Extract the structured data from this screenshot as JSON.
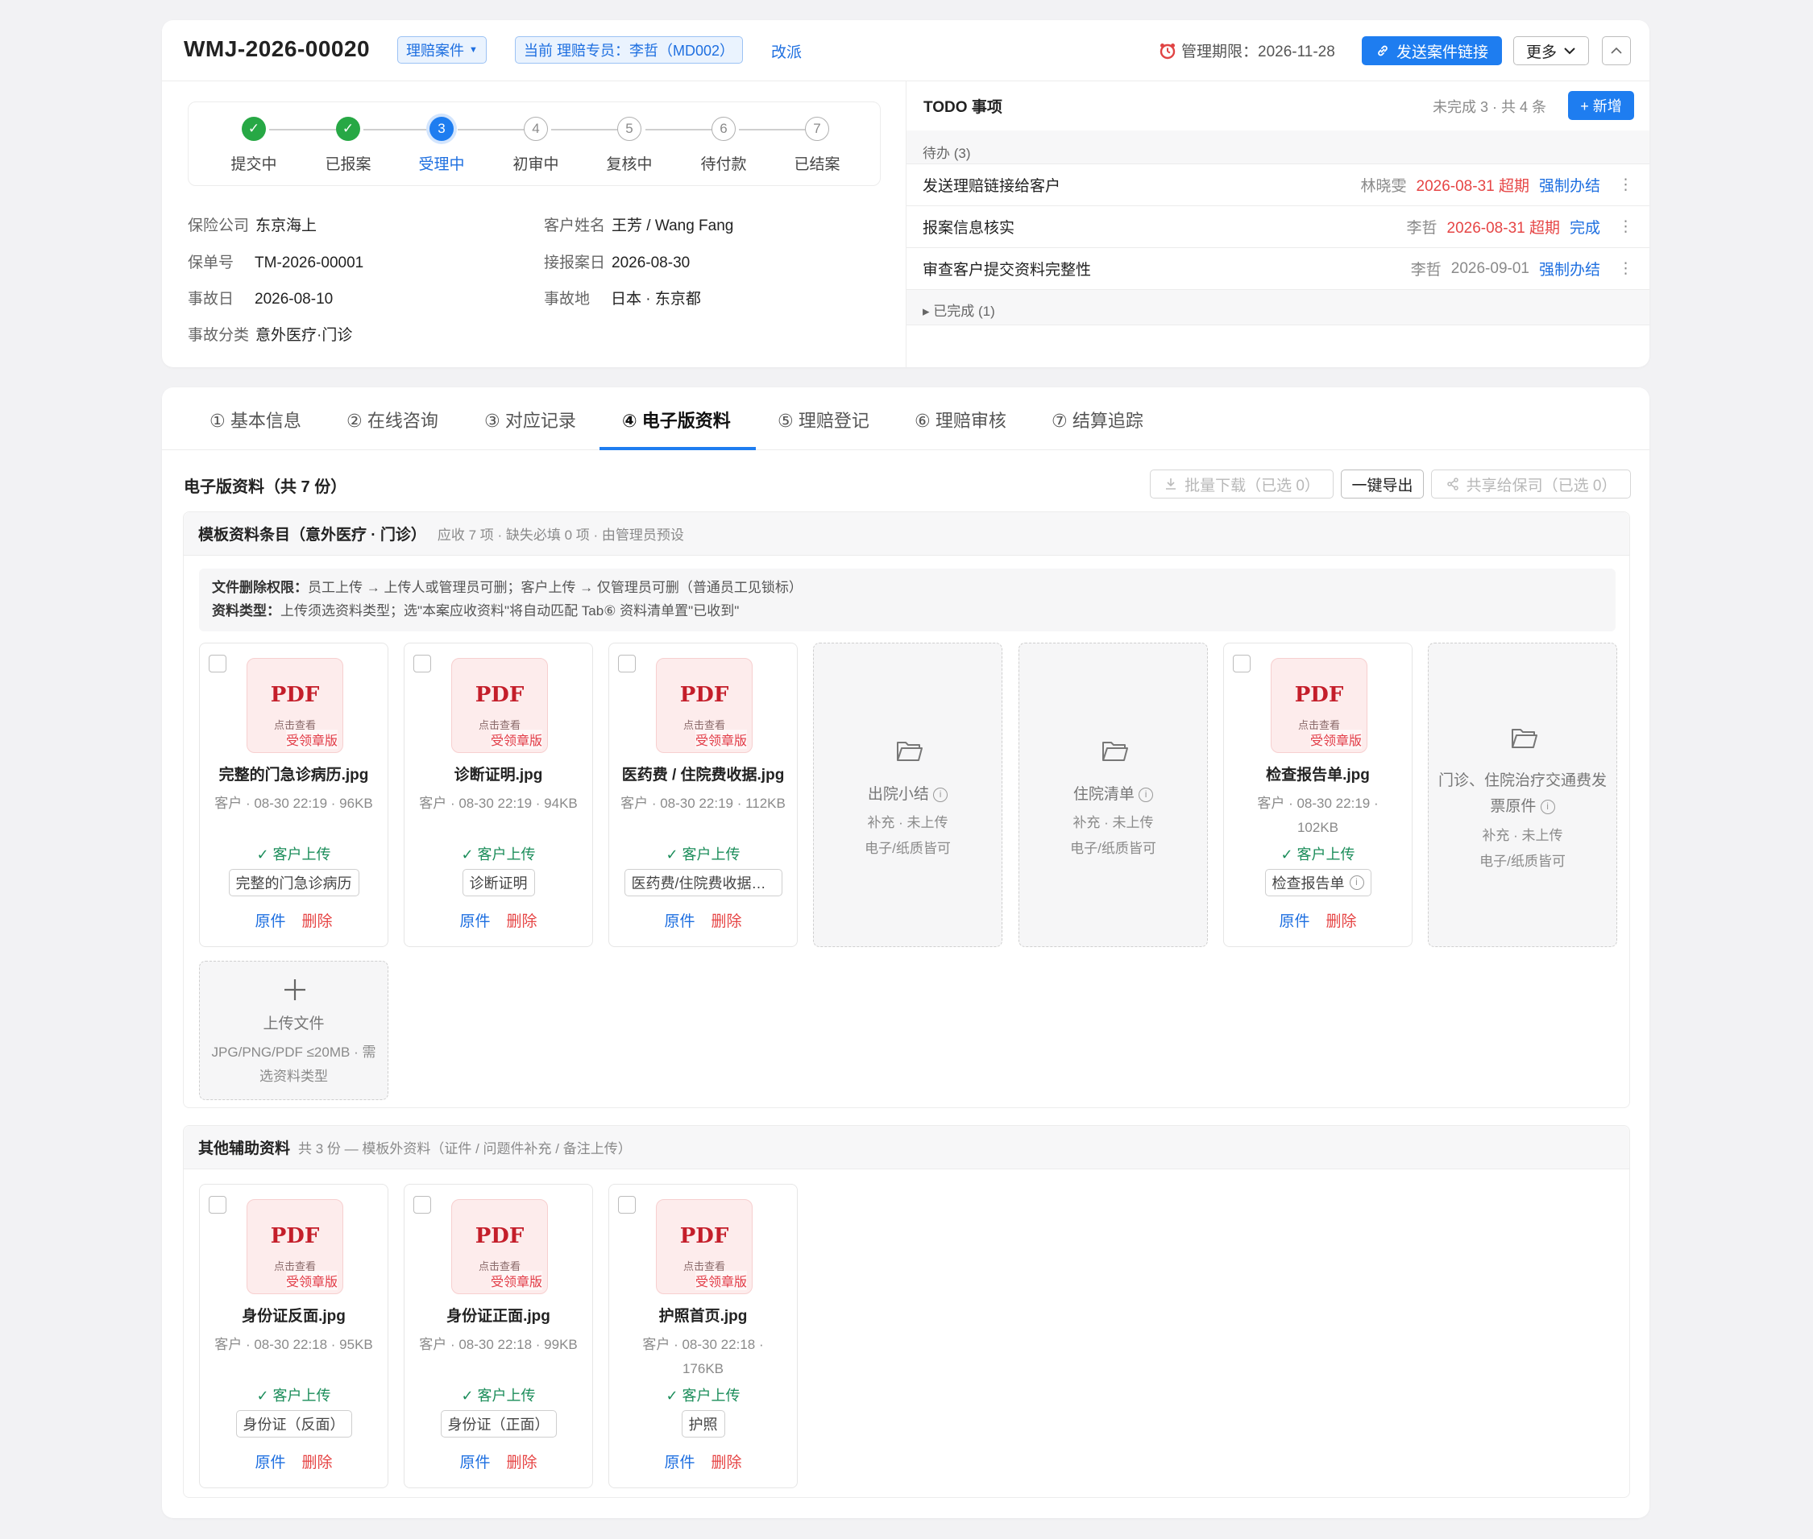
{
  "header": {
    "case_id": "WMJ-2026-00020",
    "case_type": "理赔案件",
    "assignee": "当前 理赔专员：李哲（MD002）",
    "reassign": "改派",
    "deadline": "管理期限：2026-11-28",
    "send_link": "发送案件链接",
    "more": "更多"
  },
  "steps": [
    {
      "num": "1",
      "label": "提交中",
      "state": "done"
    },
    {
      "num": "2",
      "label": "已报案",
      "state": "done"
    },
    {
      "num": "3",
      "label": "受理中",
      "state": "current"
    },
    {
      "num": "4",
      "label": "初审中",
      "state": "todo"
    },
    {
      "num": "5",
      "label": "复核中",
      "state": "todo"
    },
    {
      "num": "6",
      "label": "待付款",
      "state": "todo"
    },
    {
      "num": "7",
      "label": "已结案",
      "state": "todo"
    }
  ],
  "case_info": {
    "insurer_label": "保险公司",
    "insurer": "东京海上",
    "customer_label": "客户姓名",
    "customer": "王芳 / Wang Fang",
    "policy_label": "保单号",
    "policy": "TM-2026-00001",
    "report_date_label": "接报案日",
    "report_date": "2026-08-30",
    "accident_date_label": "事故日",
    "accident_date": "2026-08-10",
    "accident_place_label": "事故地",
    "accident_place": "日本 · 东京都",
    "category_label": "事故分类",
    "category": "意外医疗·门诊"
  },
  "todo": {
    "title": "TODO 事项",
    "summary": "未完成 3 · 共 4 条",
    "add": "+ 新增",
    "pending_group": "待办 (3)",
    "items": [
      {
        "title": "发送理赔链接给客户",
        "owner": "林晓雯",
        "date": "2026-08-31 超期",
        "overdue": true,
        "action": "强制办结"
      },
      {
        "title": "报案信息核实",
        "owner": "李哲",
        "date": "2026-08-31 超期",
        "overdue": true,
        "action": "完成"
      },
      {
        "title": "审查客户提交资料完整性",
        "owner": "李哲",
        "date": "2026-09-01",
        "overdue": false,
        "action": "强制办结"
      }
    ],
    "done_group": "▸ 已完成 (1)"
  },
  "tabs": [
    {
      "label": "① 基本信息"
    },
    {
      "label": "② 在线咨询"
    },
    {
      "label": "③ 对应记录"
    },
    {
      "label": "④ 电子版资料",
      "active": true
    },
    {
      "label": "⑤ 理赔登记"
    },
    {
      "label": "⑥ 理赔审核"
    },
    {
      "label": "⑦ 结算追踪"
    }
  ],
  "docs": {
    "title": "电子版资料（共 7 份）",
    "batch_download": "批量下载（已选 0）",
    "export": "一键导出",
    "share": "共享给保司（已选 0）",
    "template_title": "模板资料条目（意外医疗 · 门诊）",
    "template_sub": "应收 7 项 · 缺失必填 0 项 · 由管理员预设",
    "note_1_label": "文件删除权限：",
    "note_1": "员工上传 → 上传人或管理员可删；客户上传 → 仅管理员可删（普通员工见锁标）",
    "note_2_label": "资料类型：",
    "note_2": "上传须选资料类型；选\"本案应收资料\"将自动匹配 Tab⑥ 资料清单置\"已收到\"",
    "pdf_label": "PDF",
    "pdf_view": "点击查看",
    "pdf_stamp": "受领章版",
    "original": "原件",
    "delete": "删除",
    "template_files": [
      {
        "name": "完整的门急诊病历.jpg",
        "meta": "客户 · 08-30 22:19 · 96KB",
        "uploader": "✓ 客户上传",
        "tag": "完整的门急诊病历"
      },
      {
        "name": "诊断证明.jpg",
        "meta": "客户 · 08-30 22:19 · 94KB",
        "uploader": "✓ 客户上传",
        "tag": "诊断证明"
      },
      {
        "name": "医药费 / 住院费收据.jpg",
        "meta": "客户 · 08-30 22:19 · 112KB",
        "uploader": "✓ 客户上传",
        "tag": "医药费/住院费收据原件"
      },
      {
        "empty": true,
        "name": "出院小结",
        "status": "补充 · 未上传",
        "hint": "电子/纸质皆可"
      },
      {
        "empty": true,
        "name": "住院清单",
        "status": "补充 · 未上传",
        "hint": "电子/纸质皆可"
      },
      {
        "name": "检查报告单.jpg",
        "meta": "客户 · 08-30 22:19 · 102KB",
        "uploader": "✓ 客户上传",
        "tag": "检查报告单",
        "tag_info": true
      },
      {
        "empty": true,
        "name": "门诊、住院治疗交通费发票原件",
        "status": "补充 · 未上传",
        "hint": "电子/纸质皆可"
      }
    ],
    "upload": {
      "label": "上传文件",
      "hint": "JPG/PNG/PDF ≤20MB · 需选资料类型"
    },
    "other_title": "其他辅助资料",
    "other_sub": "共 3 份 — 模板外资料（证件 / 问题件补充 / 备注上传）",
    "other_files": [
      {
        "name": "身份证反面.jpg",
        "meta": "客户 · 08-30 22:18 · 95KB",
        "uploader": "✓ 客户上传",
        "tag": "身份证（反面）"
      },
      {
        "name": "身份证正面.jpg",
        "meta": "客户 · 08-30 22:18 · 99KB",
        "uploader": "✓ 客户上传",
        "tag": "身份证（正面）"
      },
      {
        "name": "护照首页.jpg",
        "meta": "客户 · 08-30 22:18 · 176KB",
        "uploader": "✓ 客户上传",
        "tag": "护照"
      }
    ]
  },
  "colors": {
    "accent": "#1e7df0",
    "success": "#27a845",
    "danger": "#e64545",
    "stamp": "#c41e2a"
  }
}
